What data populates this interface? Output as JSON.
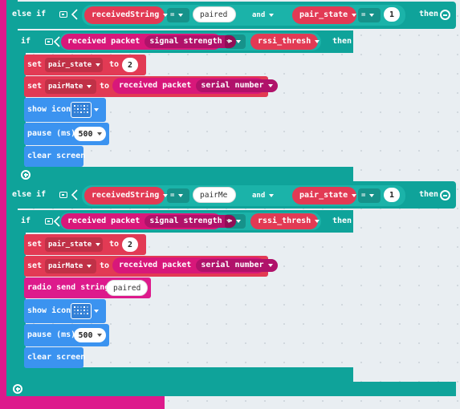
{
  "colors": {
    "teal": "#0fa39a",
    "magenta": "#dd1a8c",
    "blue": "#3b93f0",
    "red": "#e23a54",
    "pink": "#d8177a",
    "workspace": "#e9eef2"
  },
  "icons": [
    "gear-icon",
    "dropdown-arrow-icon",
    "remove-circle-icon",
    "add-circle-icon",
    "led-pattern-icon"
  ],
  "block1": {
    "else_if": "else if",
    "var1": "receivedString",
    "op1": "=",
    "str1": "paired",
    "and": "and",
    "var2": "pair_state",
    "op2": "=",
    "num2": "1",
    "then": "then",
    "inner_if": "if",
    "packet": "received packet",
    "prop": "signal strength",
    "cmp": ">",
    "thresh": "rssi_thresh",
    "inner_then": "then",
    "set1_kw": "set",
    "set1_var": "pair_state",
    "set1_to": "to",
    "set1_val": "2",
    "set2_kw": "set",
    "set2_var": "pairMate",
    "set2_to": "to",
    "set2_packet": "received packet",
    "set2_prop": "serial number",
    "show_icon": "show icon",
    "pause": "pause (ms)",
    "pause_val": "500",
    "clear": "clear screen"
  },
  "block2": {
    "else_if": "else if",
    "var1": "receivedString",
    "op1": "=",
    "str1": "pairMe",
    "and": "and",
    "var2": "pair_state",
    "op2": "=",
    "num2": "1",
    "then": "then",
    "inner_if": "if",
    "packet": "received packet",
    "prop": "signal strength",
    "cmp": ">",
    "thresh": "rssi_thresh",
    "inner_then": "then",
    "set1_kw": "set",
    "set1_var": "pair_state",
    "set1_to": "to",
    "set1_val": "2",
    "set2_kw": "set",
    "set2_var": "pairMate",
    "set2_to": "to",
    "set2_packet": "received packet",
    "set2_prop": "serial number",
    "radio": "radio send string",
    "radio_str": "paired",
    "show_icon": "show icon",
    "pause": "pause (ms)",
    "pause_val": "500",
    "clear": "clear screen"
  }
}
